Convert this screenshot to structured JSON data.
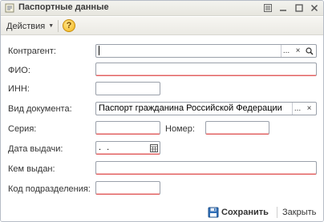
{
  "window": {
    "title": "Паспортные данные"
  },
  "toolbar": {
    "actions_label": "Действия",
    "help_label": "?"
  },
  "form": {
    "counterparty": {
      "label": "Контрагент:",
      "value": ""
    },
    "full_name": {
      "label": "ФИО:",
      "value": ""
    },
    "inn": {
      "label": "ИНН:",
      "value": ""
    },
    "doc_type": {
      "label": "Вид документа:",
      "value": "Паспорт гражданина Российской Федерации"
    },
    "series": {
      "label": "Серия:",
      "value": ""
    },
    "number": {
      "label": "Номер:",
      "value": ""
    },
    "issue_date": {
      "label": "Дата выдачи:",
      "value": " .  .    "
    },
    "issued_by": {
      "label": "Кем выдан:",
      "value": ""
    },
    "dept_code": {
      "label": "Код подразделения:",
      "value": ""
    }
  },
  "footer": {
    "save_label": "Сохранить",
    "close_label": "Закрыть"
  },
  "icons": {
    "select": "...",
    "clear": "×",
    "search": "search-icon",
    "calendar": "calendar-icon"
  },
  "colors": {
    "required_underline": "#e06060",
    "help_fill": "#f2b51a",
    "save_icon": "#2f6fb8"
  }
}
